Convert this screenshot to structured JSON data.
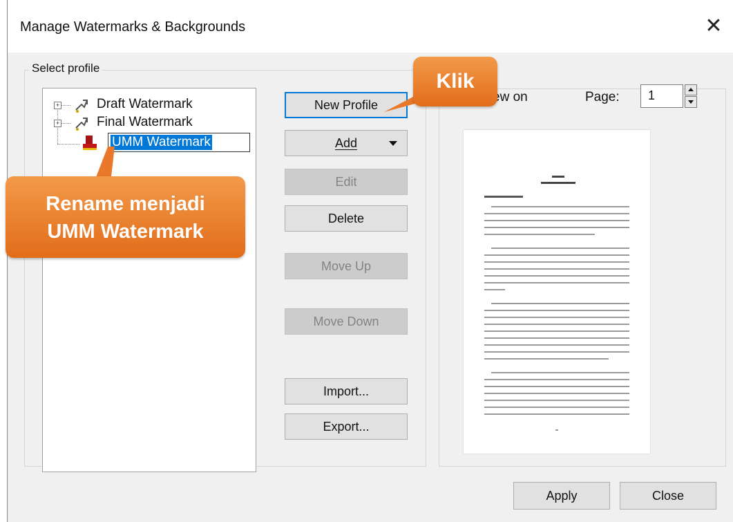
{
  "dialog": {
    "title": "Manage Watermarks & Backgrounds",
    "close_glyph": "✕"
  },
  "profile": {
    "label": "Select profile",
    "tree": [
      {
        "label": "Draft Watermark",
        "icon": "watermark-icon",
        "expandable": true
      },
      {
        "label": "Final Watermark",
        "icon": "watermark-icon",
        "expandable": true
      },
      {
        "label": "UMM Watermark",
        "icon": "stamp-icon",
        "editing": true
      }
    ]
  },
  "buttons": {
    "new_profile": "New Profile",
    "add": "Add",
    "edit": "Edit",
    "delete": "Delete",
    "move_up": "Move Up",
    "move_down": "Move Down",
    "import": "Import...",
    "export": "Export..."
  },
  "preview": {
    "label": "ew on",
    "page_label": "Page:",
    "page_value": "1"
  },
  "callouts": {
    "klik": "Klik",
    "rename_line1": "Rename menjadi",
    "rename_line2": "UMM Watermark",
    "color": "#ea7f2c"
  },
  "footer": {
    "apply": "Apply",
    "close": "Close"
  }
}
